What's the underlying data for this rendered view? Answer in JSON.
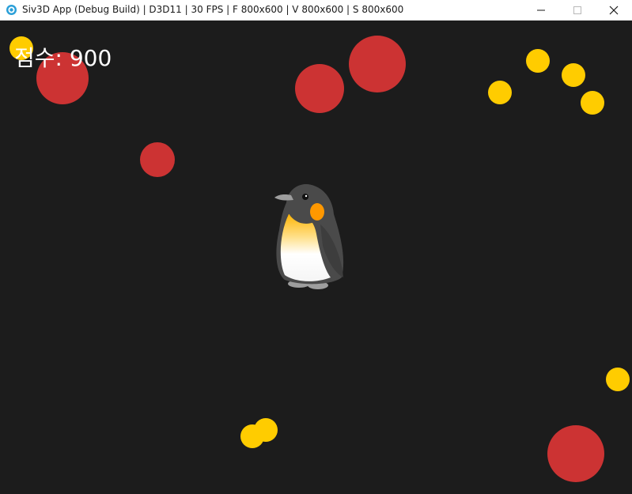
{
  "window": {
    "title": "Siv3D App (Debug Build) | D3D11 | 30 FPS | F 800x600 | V 800x600 | S 800x600",
    "icon": "siv3d-app-icon",
    "controls": [
      "minimize-icon",
      "maximize-icon",
      "close-icon"
    ]
  },
  "game": {
    "background_color": "#1c1c1c",
    "score_text": "점수: 900",
    "player": {
      "sprite": "penguin"
    },
    "enemy_color": "#cc3333",
    "coin_color": "#ffcc00"
  }
}
